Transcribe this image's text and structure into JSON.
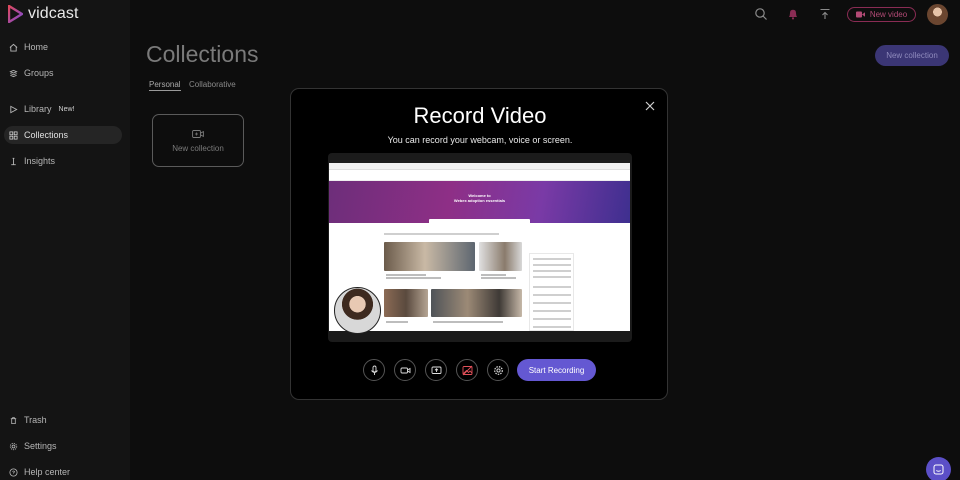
{
  "app": {
    "name": "vidcast"
  },
  "sidebar": {
    "items": [
      {
        "label": "Home",
        "icon": "home-icon"
      },
      {
        "label": "Groups",
        "icon": "groups-icon"
      },
      {
        "label": "Library",
        "icon": "library-icon",
        "badge": "New!"
      },
      {
        "label": "Collections",
        "icon": "collections-icon",
        "active": true
      },
      {
        "label": "Insights",
        "icon": "insights-icon"
      }
    ],
    "bottom_items": [
      {
        "label": "Trash",
        "icon": "trash-icon"
      },
      {
        "label": "Settings",
        "icon": "settings-icon"
      },
      {
        "label": "Help center",
        "icon": "help-icon"
      }
    ]
  },
  "topbar": {
    "new_video_label": "New video",
    "icons": [
      "search-icon",
      "notification-bell-icon",
      "upload-icon"
    ]
  },
  "page": {
    "title": "Collections",
    "tabs": [
      {
        "label": "Personal",
        "active": true
      },
      {
        "label": "Collaborative",
        "active": false
      }
    ],
    "new_collection_button": "New collection",
    "new_collection_card": "New collection"
  },
  "modal": {
    "title": "Record Video",
    "subtitle": "You can record your webcam, voice or screen.",
    "preview_hero_line1": "Welcome to",
    "preview_hero_line2": "Webex adoption essentials",
    "start_button": "Start Recording",
    "controls": [
      "microphone-icon",
      "camera-icon",
      "screen-share-icon",
      "image-icon",
      "settings-gear-icon"
    ]
  },
  "colors": {
    "accent": "#6458d2",
    "new_video": "#b24a75",
    "background": "#0b0b0b"
  }
}
